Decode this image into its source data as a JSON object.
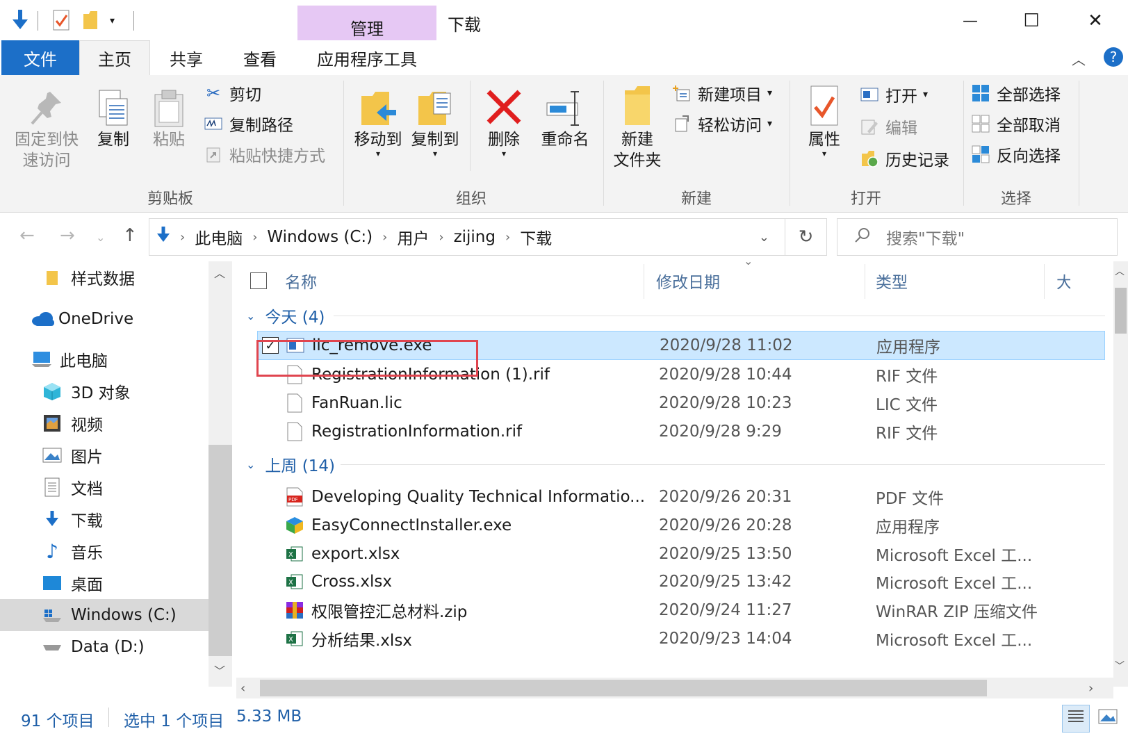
{
  "title_bar": {
    "context_tab": "管理",
    "window_title": "下载",
    "minimize": "—",
    "maximize": "☐",
    "close": "✕"
  },
  "tabs": {
    "file": "文件",
    "home": "主页",
    "share": "共享",
    "view": "查看",
    "app_tools": "应用程序工具",
    "help": "?"
  },
  "ribbon": {
    "clipboard": {
      "pin": "固定到快速访问",
      "pin_line1": "固定到快",
      "pin_line2": "速访问",
      "copy": "复制",
      "paste": "粘贴",
      "cut": "剪切",
      "copy_path": "复制路径",
      "paste_shortcut": "粘贴快捷方式",
      "label": "剪贴板"
    },
    "organize": {
      "move_to": "移动到",
      "copy_to": "复制到",
      "delete": "删除",
      "rename": "重命名",
      "label": "组织"
    },
    "new": {
      "new_folder_line1": "新建",
      "new_folder_line2": "文件夹",
      "new_item": "新建项目",
      "easy_access": "轻松访问",
      "label": "新建"
    },
    "open": {
      "properties": "属性",
      "open": "打开",
      "edit": "编辑",
      "history": "历史记录",
      "label": "打开"
    },
    "select": {
      "select_all": "全部选择",
      "select_none": "全部取消",
      "invert": "反向选择",
      "label": "选择"
    }
  },
  "address": {
    "crumbs": [
      "此电脑",
      "Windows (C:)",
      "用户",
      "zijing",
      "下载"
    ],
    "search_placeholder": "搜索\"下载\""
  },
  "nav_pane": {
    "items": [
      {
        "label": "样式数据"
      },
      {
        "label": "OneDrive"
      },
      {
        "label": "此电脑"
      },
      {
        "label": "3D 对象"
      },
      {
        "label": "视频"
      },
      {
        "label": "图片"
      },
      {
        "label": "文档"
      },
      {
        "label": "下载"
      },
      {
        "label": "音乐"
      },
      {
        "label": "桌面"
      },
      {
        "label": "Windows (C:)"
      },
      {
        "label": "Data (D:)"
      }
    ]
  },
  "columns": {
    "name": "名称",
    "date": "修改日期",
    "type": "类型",
    "size": "大小"
  },
  "groups": [
    {
      "label": "今天 (4)",
      "rows": [
        {
          "name": "lic_remove.exe",
          "date": "2020/9/28 11:02",
          "type": "应用程序"
        },
        {
          "name": "RegistrationInformation (1).rif",
          "date": "2020/9/28 10:44",
          "type": "RIF 文件"
        },
        {
          "name": "FanRuan.lic",
          "date": "2020/9/28 10:23",
          "type": "LIC 文件"
        },
        {
          "name": "RegistrationInformation.rif",
          "date": "2020/9/28 9:29",
          "type": "RIF 文件"
        }
      ]
    },
    {
      "label": "上周 (14)",
      "rows": [
        {
          "name": "Developing Quality Technical Informatio...",
          "date": "2020/9/26 20:31",
          "type": "PDF 文件"
        },
        {
          "name": "EasyConnectInstaller.exe",
          "date": "2020/9/26 20:28",
          "type": "应用程序"
        },
        {
          "name": "export.xlsx",
          "date": "2020/9/25 13:50",
          "type": "Microsoft Excel 工..."
        },
        {
          "name": "Cross.xlsx",
          "date": "2020/9/25 13:42",
          "type": "Microsoft Excel 工..."
        },
        {
          "name": "权限管控汇总材料.zip",
          "date": "2020/9/24 11:27",
          "type": "WinRAR ZIP 压缩文件"
        },
        {
          "name": "分析结果.xlsx",
          "date": "2020/9/23 14:04",
          "type": "Microsoft Excel 工..."
        }
      ]
    }
  ],
  "status": {
    "count": "91 个项目",
    "selected": "选中 1 个项目",
    "size": "5.33 MB"
  },
  "colors": {
    "accent": "#1c6fc8",
    "context_tab": "#e6c8f4",
    "selection": "#cce8ff",
    "highlight_box": "#e0454f"
  }
}
